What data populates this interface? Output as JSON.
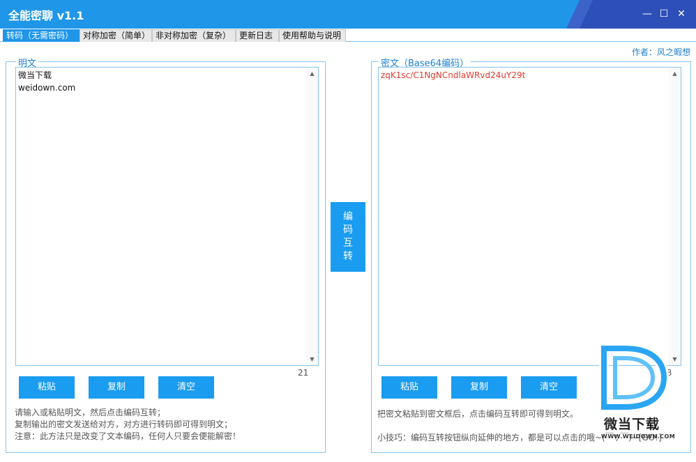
{
  "window": {
    "title": "全能密聊 v1.1",
    "controls": {
      "minimize": "—",
      "maximize": "☐",
      "close": "✕"
    }
  },
  "tabs": [
    {
      "label": "转码（无需密码）",
      "active": true
    },
    {
      "label": "对称加密（简单）",
      "active": false
    },
    {
      "label": "非对称加密（复杂）",
      "active": false
    },
    {
      "label": "更新日志",
      "active": false
    },
    {
      "label": "使用帮助与说明",
      "active": false
    }
  ],
  "author": "作者：风之暇想",
  "plaintext": {
    "label": "明文",
    "value": "微当下载\nweidown.com",
    "char_count": "21",
    "buttons": {
      "paste": "粘贴",
      "copy": "复制",
      "clear": "清空"
    },
    "hints": [
      "请输入或粘贴明文，然后点击编码互转；",
      "复制输出的密文发送给对方，对方进行转码即可得到明文；",
      "注意：此方法只是改变了文本编码，任何人只要会便能解密！"
    ]
  },
  "ciphertext": {
    "label": "密文（Base64编码）",
    "value": "zqK1sc/C1NgNCndlaWRvd24uY29t",
    "char_count": "28",
    "buttons": {
      "paste": "粘贴",
      "copy": "复制",
      "clear": "清空"
    },
    "hints": [
      "把密文粘贴到密文框后，点击编码互转即可得到明文。",
      "小技巧：编码互转按钮纵向延伸的地方，都是可以点击的哦~(￣▽￣)~[GO!]"
    ]
  },
  "convert_button": {
    "chars": [
      "编",
      "码",
      "互",
      "转"
    ]
  },
  "watermark": {
    "brand": "微当下载",
    "url": "WWW.WEIDOWN.COM"
  },
  "colors": {
    "accent": "#1f96e8",
    "button": "#1a9cf0",
    "cipher_text": "#e03a2e"
  }
}
